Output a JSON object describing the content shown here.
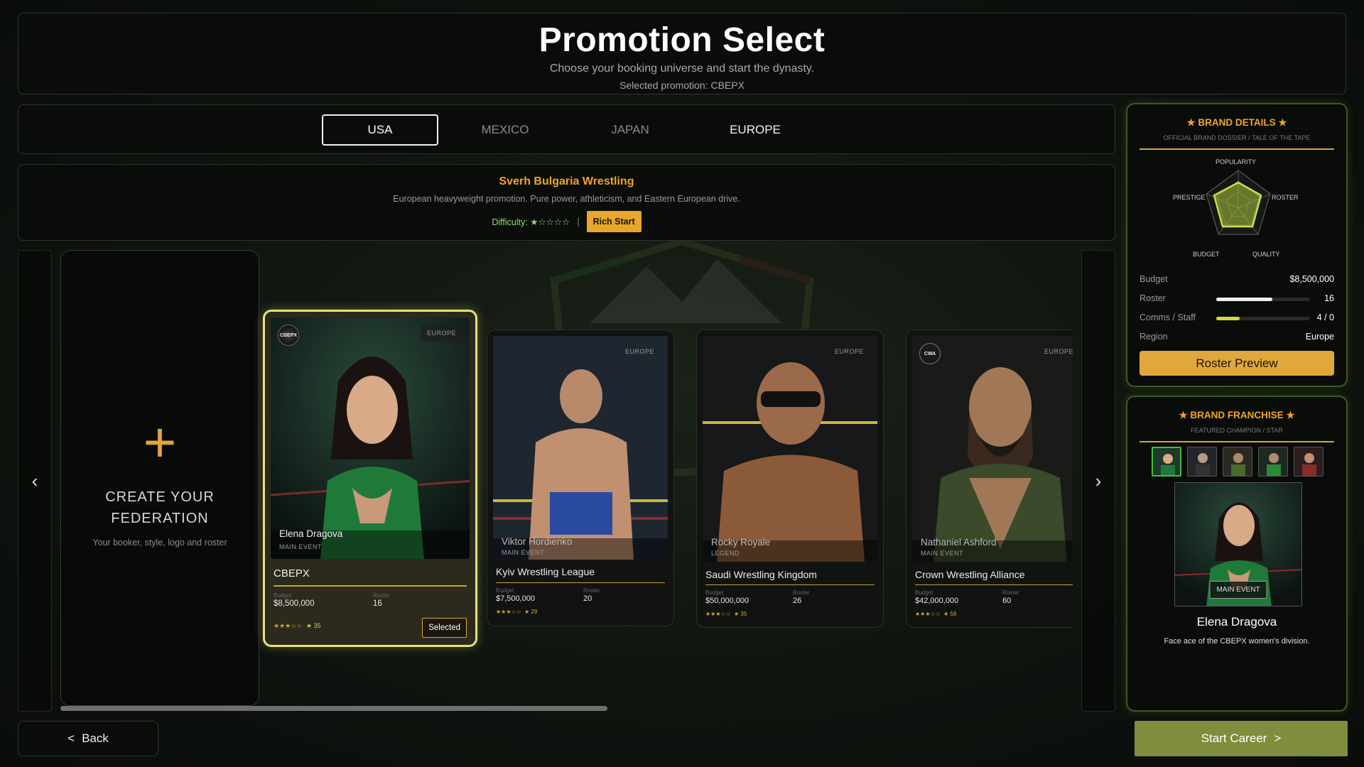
{
  "header": {
    "title": "Promotion Select",
    "subtitle": "Choose your booking universe and start the dynasty.",
    "selected_text": "Selected promotion: CBEPX"
  },
  "tabs": [
    {
      "label": "USA",
      "active": true
    },
    {
      "label": "MEXICO",
      "active": false
    },
    {
      "label": "JAPAN",
      "active": false
    },
    {
      "label": "EUROPE",
      "active": false
    }
  ],
  "promo_info": {
    "name": "Sverh Bulgaria Wrestling",
    "description": "European heavyweight promotion. Pure power, athleticism, and Eastern European drive.",
    "difficulty_label": "Difficulty: ★☆☆☆☆",
    "separator": "|",
    "start_badge": "Rich Start"
  },
  "carousel": {
    "prev": "‹",
    "next": "›",
    "create_card": {
      "plus": "+",
      "title_line1": "CREATE YOUR",
      "title_line2": "FEDERATION",
      "subtitle": "Your booker, style, logo and roster"
    },
    "cards": [
      {
        "wrestler": "Elena Dragova",
        "tier": "MAIN EVENT",
        "region": "EUROPE",
        "logo": "CBEPX",
        "promotion": "CBEPX",
        "budget_label": "Budget",
        "budget": "$8,500,000",
        "roster_label": "Roster",
        "roster": "16",
        "stars": "★★★☆☆",
        "rating": "★ 35",
        "selected_label": "Selected"
      },
      {
        "wrestler": "Viktor Hordienko",
        "tier": "MAIN EVENT",
        "region": "EUROPE",
        "promotion": "Kyiv Wrestling League",
        "budget_label": "Budget",
        "budget": "$7,500,000",
        "roster_label": "Roster",
        "roster": "20",
        "stars": "★★★☆☆",
        "rating": "★ 29"
      },
      {
        "wrestler": "Rocky Royale",
        "tier": "LEGEND",
        "region": "EUROPE",
        "promotion": "Saudi Wrestling Kingdom",
        "budget_label": "Budget",
        "budget": "$50,000,000",
        "roster_label": "Roster",
        "roster": "26",
        "stars": "★★★☆☆",
        "rating": "★ 35"
      },
      {
        "wrestler": "Nathaniel Ashford",
        "tier": "MAIN EVENT",
        "region": "EUROPE",
        "logo": "CWA",
        "promotion": "Crown Wrestling Alliance",
        "budget_label": "Budget",
        "budget": "$42,000,000",
        "roster_label": "Roster",
        "roster": "60",
        "stars": "★★★☆☆",
        "rating": "★ 58"
      }
    ]
  },
  "brand_details": {
    "title": "★ BRAND DETAILS ★",
    "subtitle": "OFFICIAL BRAND DOSSIER / TALE OF THE TAPE",
    "radar_labels": {
      "top": "POPULARITY",
      "left": "PRESTIGE",
      "right": "ROSTER",
      "bottom_left": "BUDGET",
      "bottom_right": "QUALITY"
    },
    "rows": [
      {
        "label": "Budget",
        "value": "$8,500,000"
      },
      {
        "label": "Roster",
        "value": "16",
        "fill": 0.6
      },
      {
        "label": "Comms / Staff",
        "value": "4 / 0",
        "fill": 0.25
      },
      {
        "label": "Region",
        "value": "Europe"
      }
    ],
    "button": "Roster Preview"
  },
  "brand_franchise": {
    "title": "★ BRAND FRANCHISE ★",
    "subtitle": "FEATURED CHAMPION / STAR",
    "champion_badge": "MAIN EVENT",
    "champion_name": "Elena Dragova",
    "champion_desc": "Face ace of the CBEPX women's division."
  },
  "footer": {
    "back_icon": "<",
    "back_label": "Back",
    "start_label": "Start Career",
    "start_icon": ">"
  }
}
